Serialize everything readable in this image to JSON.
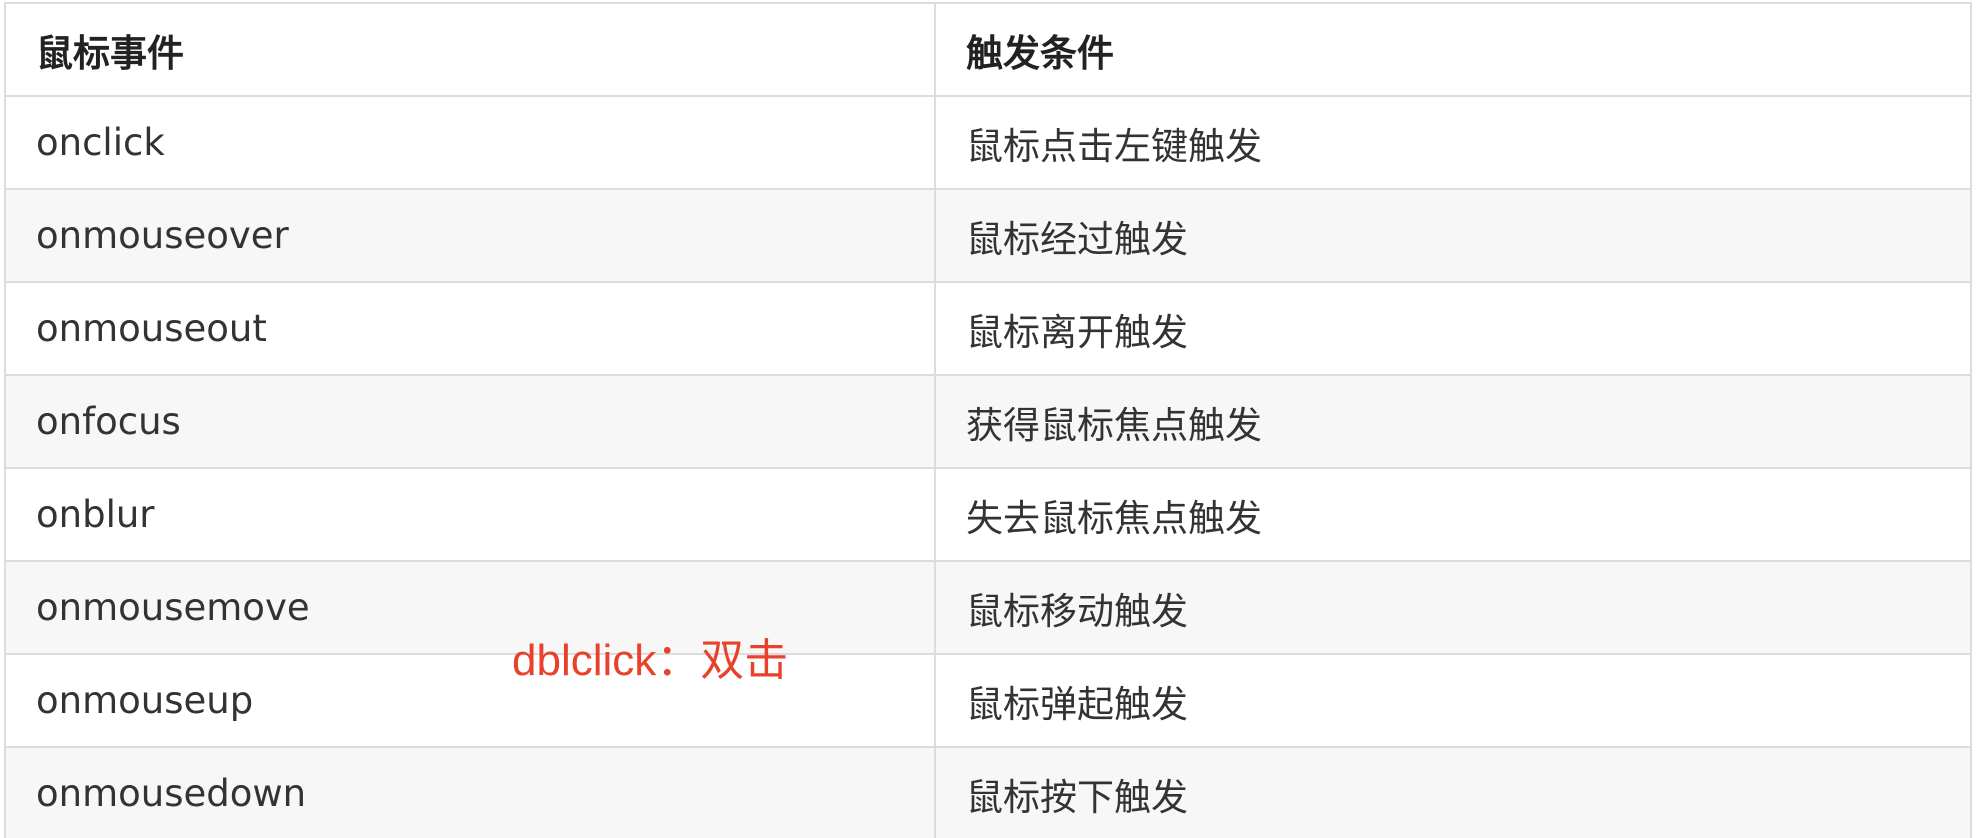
{
  "table": {
    "headers": [
      "鼠标事件",
      "触发条件"
    ],
    "rows": [
      {
        "event": "onclick",
        "condition": "鼠标点击左键触发"
      },
      {
        "event": "onmouseover",
        "condition": "鼠标经过触发"
      },
      {
        "event": "onmouseout",
        "condition": "鼠标离开触发"
      },
      {
        "event": "onfocus",
        "condition": "获得鼠标焦点触发"
      },
      {
        "event": "onblur",
        "condition": "失去鼠标焦点触发"
      },
      {
        "event": "onmousemove",
        "condition": "鼠标移动触发"
      },
      {
        "event": "onmouseup",
        "condition": "鼠标弹起触发"
      },
      {
        "event": "onmousedown",
        "condition": "鼠标按下触发"
      }
    ]
  },
  "annotation": {
    "text": "dblclick：双击",
    "color": "#e8412c"
  },
  "colors": {
    "border": "#dcdcdc",
    "stripe": "#f7f7f7",
    "text": "#333333"
  }
}
